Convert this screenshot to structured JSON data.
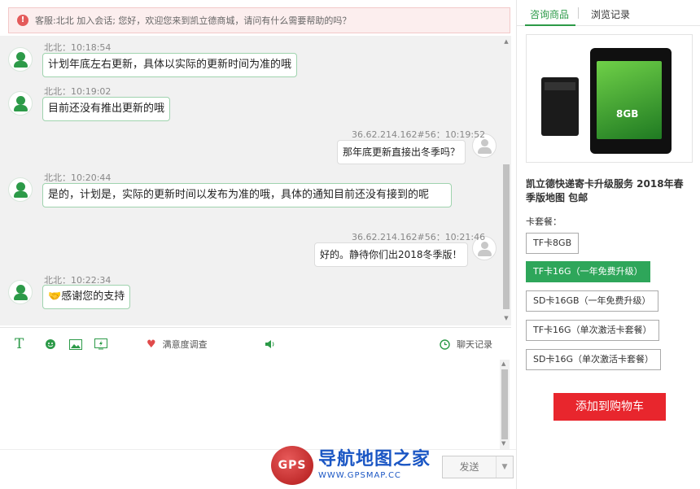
{
  "notice": {
    "text": "客服:北北 加入会话; 您好，欢迎您来到凯立德商城，请问有什么需要帮助的吗？",
    "icon": "alert-icon"
  },
  "messages": [
    {
      "from": "agent",
      "sender": "北北",
      "time": "10:18:54",
      "text": "计划年底左右更新，具体以实际的更新时间为准的哦"
    },
    {
      "from": "agent",
      "sender": "北北",
      "time": "10:19:02",
      "text": "目前还没有推出更新的哦"
    },
    {
      "from": "user",
      "sender": "36.62.214.162#56",
      "time": "10:19:52",
      "text": "那年底更新直接出冬季吗？"
    },
    {
      "from": "agent",
      "sender": "北北",
      "time": "10:20:44",
      "text": "是的，计划是，实际的更新时间以发布为准的哦，具体的通知目前还没有接到的呢"
    },
    {
      "from": "user",
      "sender": "36.62.214.162#56",
      "time": "10:21:46",
      "text": "好的。静待你们出2018冬季版！"
    },
    {
      "from": "agent",
      "sender": "北北",
      "time": "10:22:34",
      "text": "感谢您的支持",
      "emoji": "handshake-icon"
    }
  ],
  "labels": {
    "msg0": "北北：10:18:54",
    "msg1": "北北：10:19:02",
    "msg2": "36.62.214.162#56：10:19:52",
    "msg3": "北北：10:20:44",
    "msg4": "36.62.214.162#56：10:21:46",
    "msg5": "北北：10:22:34"
  },
  "toolbar": {
    "font_icon": "T",
    "satisfaction_label": "满意度调查",
    "history_label": "聊天记录"
  },
  "compose": {
    "value": "",
    "send_label": "发送",
    "send_dropdown": "▼"
  },
  "watermark": {
    "badge": "GPS",
    "title": "导航地图之家",
    "url": "WWW.GPSMAP.CC"
  },
  "side": {
    "tabs": [
      "咨询商品",
      "浏览记录"
    ],
    "active_tab": 0,
    "product_name": "凯立德快递寄卡升级服务 2018年春季版地图 包邮",
    "image_card_text": "8GB",
    "options_title": "卡套餐：",
    "options": [
      "TF卡8GB",
      "TF卡16G（一年免费升级）",
      "SD卡16GB（一年免费升级）",
      "TF卡16G（单次激活卡套餐）",
      "SD卡16G（单次激活卡套餐）"
    ],
    "selected_option": 1,
    "cart_label": "添加到购物车"
  },
  "colors": {
    "accent": "#2c9a48",
    "selected": "#2ea65a",
    "cart": "#e8262d",
    "notice_bg": "#fceeee"
  }
}
